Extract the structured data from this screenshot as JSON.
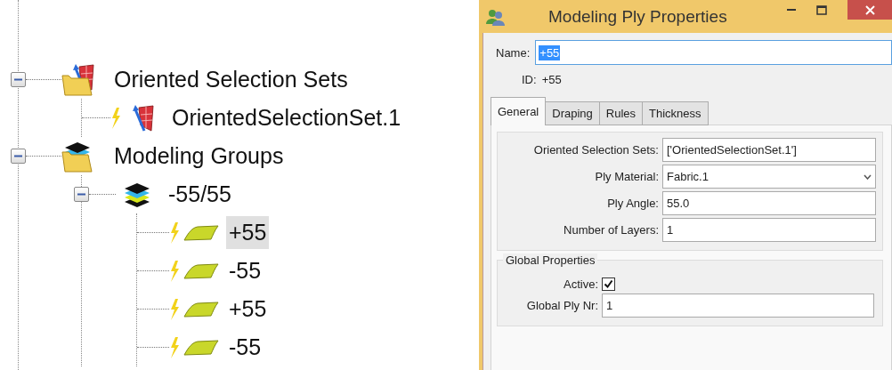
{
  "tree": [
    {
      "label": "Oriented Selection Sets",
      "kind": "oss-folder",
      "expanded": true,
      "selected": false,
      "children": [
        {
          "label": "OrientedSelectionSet.1",
          "kind": "oss",
          "selected": false
        }
      ]
    },
    {
      "label": "Modeling Groups",
      "kind": "group-folder",
      "expanded": true,
      "selected": false,
      "children": [
        {
          "label": "-55/55",
          "kind": "group",
          "expanded": true,
          "selected": false,
          "children": [
            {
              "label": "+55",
              "kind": "ply",
              "selected": true
            },
            {
              "label": "-55",
              "kind": "ply",
              "selected": false
            },
            {
              "label": "+55",
              "kind": "ply",
              "selected": false
            },
            {
              "label": "-55",
              "kind": "ply",
              "selected": false
            }
          ]
        }
      ]
    }
  ],
  "dialog": {
    "title": "Modeling Ply Properties",
    "name": {
      "label": "Name:",
      "value": "+55",
      "highlighted": true
    },
    "id": {
      "label": "ID:",
      "value": "+55"
    },
    "tabs": [
      {
        "label": "General",
        "selected": true
      },
      {
        "label": "Draping",
        "selected": false
      },
      {
        "label": "Rules",
        "selected": false
      },
      {
        "label": "Thickness",
        "selected": false
      }
    ],
    "fields": [
      {
        "kind": "text",
        "label": "Oriented Selection Sets:",
        "value": "['OrientedSelectionSet.1']"
      },
      {
        "kind": "dropdown",
        "label": "Ply Material:",
        "value": "Fabric.1"
      },
      {
        "kind": "text",
        "label": "Ply Angle:",
        "value": "55.0"
      },
      {
        "kind": "text",
        "label": "Number of Layers:",
        "value": "1"
      }
    ],
    "global_properties": {
      "title": "Global Properties",
      "fields": [
        {
          "kind": "checkbox",
          "label": "Active:",
          "checked": true
        },
        {
          "kind": "text",
          "label": "Global Ply Nr:",
          "value": "1"
        }
      ]
    }
  }
}
